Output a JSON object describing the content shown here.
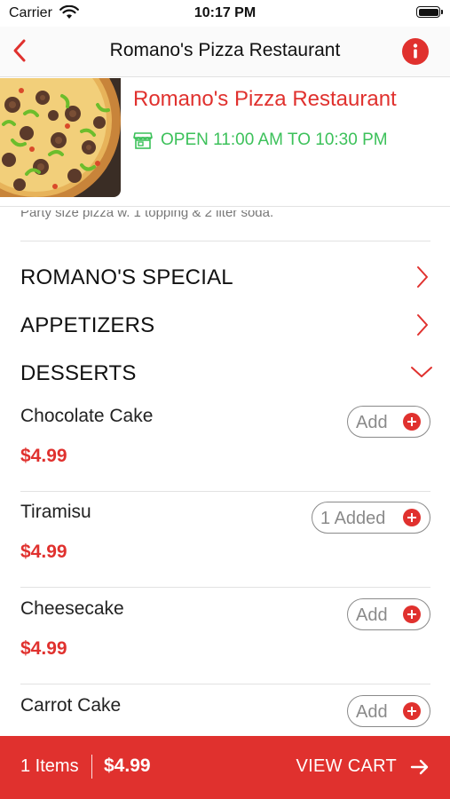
{
  "status_bar": {
    "carrier": "Carrier",
    "time": "10:17 PM"
  },
  "nav": {
    "title": "Romano's Pizza Restaurant"
  },
  "restaurant": {
    "name": "Romano's Pizza Restaurant",
    "hours": "OPEN 11:00 AM TO 10:30 PM",
    "promo": "Party size pizza w. 1 topping & 2 liter soda."
  },
  "categories": [
    {
      "label": "ROMANO'S SPECIAL",
      "state": "collapsed"
    },
    {
      "label": "APPETIZERS",
      "state": "collapsed"
    },
    {
      "label": "DESSERTS",
      "state": "expanded"
    }
  ],
  "items": [
    {
      "name": "Chocolate Cake",
      "price": "$4.99",
      "button": "Add"
    },
    {
      "name": "Tiramisu",
      "price": "$4.99",
      "button": "1 Added"
    },
    {
      "name": "Cheesecake",
      "price": "$4.99",
      "button": "Add"
    },
    {
      "name": "Carrot Cake",
      "price": "",
      "button": "Add"
    }
  ],
  "cart": {
    "count": "1 Items",
    "total": "$4.99",
    "action": "VIEW CART"
  },
  "colors": {
    "accent": "#e0312e",
    "open_green": "#3cc15a"
  }
}
